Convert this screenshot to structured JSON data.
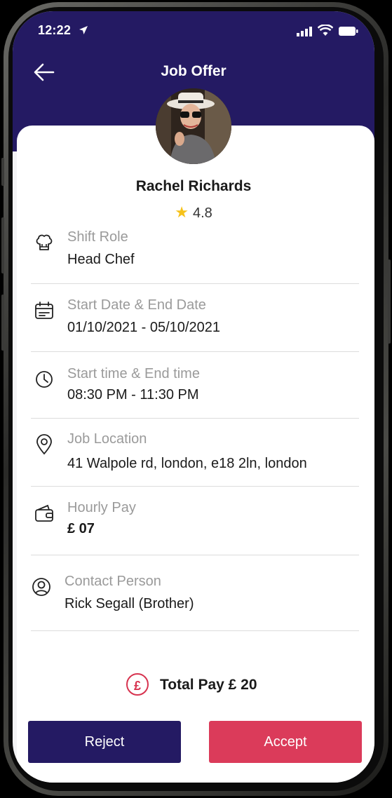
{
  "status_bar": {
    "time": "12:22"
  },
  "header": {
    "title": "Job Offer",
    "back_icon": "arrow-left-icon"
  },
  "profile": {
    "name": "Rachel Richards",
    "rating": "4.8"
  },
  "details": [
    {
      "icon": "chef-hat-icon",
      "label": "Shift Role",
      "value": "Head Chef"
    },
    {
      "icon": "calendar-icon",
      "label": "Start Date & End Date",
      "value": "01/10/2021 - 05/10/2021"
    },
    {
      "icon": "clock-icon",
      "label": "Start time & End time",
      "value": "08:30 PM - 11:30 PM"
    },
    {
      "icon": "location-pin-icon",
      "label": "Job Location",
      "value": "41 Walpole rd, london, e18 2ln, london"
    },
    {
      "icon": "wallet-icon",
      "label": "Hourly Pay",
      "value": "£ 07"
    },
    {
      "icon": "user-circle-icon",
      "label": "Contact Person",
      "value": "Rick Segall (Brother)"
    }
  ],
  "total": {
    "symbol": "£",
    "text": "Total Pay £ 20"
  },
  "actions": {
    "reject": "Reject",
    "accept": "Accept"
  },
  "colors": {
    "primary": "#241a63",
    "accent": "#db3b5a",
    "star": "#f6c21a"
  }
}
